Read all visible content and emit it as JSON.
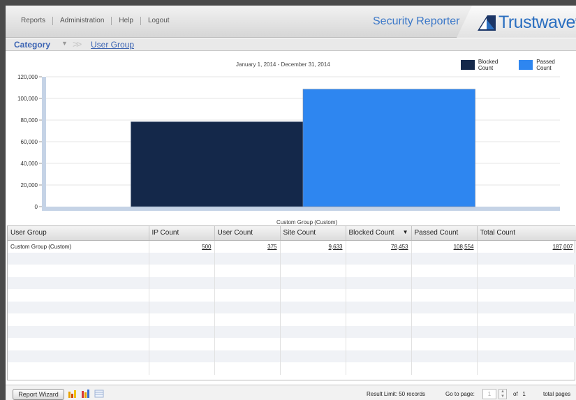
{
  "nav": {
    "items": [
      "Reports",
      "Administration",
      "Help",
      "Logout"
    ],
    "product_title": "Security Reporter",
    "logo_text": "Trustwave",
    "logo_suffix": "®"
  },
  "breadcrumb": {
    "category": "Category",
    "current": "User Group"
  },
  "colors": {
    "blocked": "#14284a",
    "passed": "#2e86f0",
    "accent": "#3d65b3"
  },
  "chart_data": {
    "type": "bar",
    "title": "January 1, 2014 - December 31, 2014",
    "categories": [
      "Custom Group (Custom)"
    ],
    "series": [
      {
        "name": "Blocked Count",
        "values": [
          78453
        ]
      },
      {
        "name": "Passed Count",
        "values": [
          108554
        ]
      }
    ],
    "ylim": [
      0,
      120000
    ],
    "yticks": [
      "0",
      "20,000",
      "40,000",
      "60,000",
      "80,000",
      "100,000",
      "120,000"
    ],
    "xlabel": "Custom Group (Custom)",
    "legend": "top-right",
    "grid": true
  },
  "table": {
    "columns": [
      "User Group",
      "IP Count",
      "User Count",
      "Site Count",
      "Blocked Count",
      "Passed Count",
      "Total Count"
    ],
    "sort_indicator": "▼",
    "rows": [
      [
        "Custom Group (Custom)",
        "500",
        "375",
        "9,633",
        "78,453",
        "108,554",
        "187,007"
      ]
    ]
  },
  "footer": {
    "wizard_label": "Report Wizard",
    "result_limit": "Result Limit: 50 records",
    "go_to_page": "Go to page:",
    "page_value": "1",
    "of_label": "of",
    "total_pages": "1",
    "total_pages_label": "total pages"
  }
}
